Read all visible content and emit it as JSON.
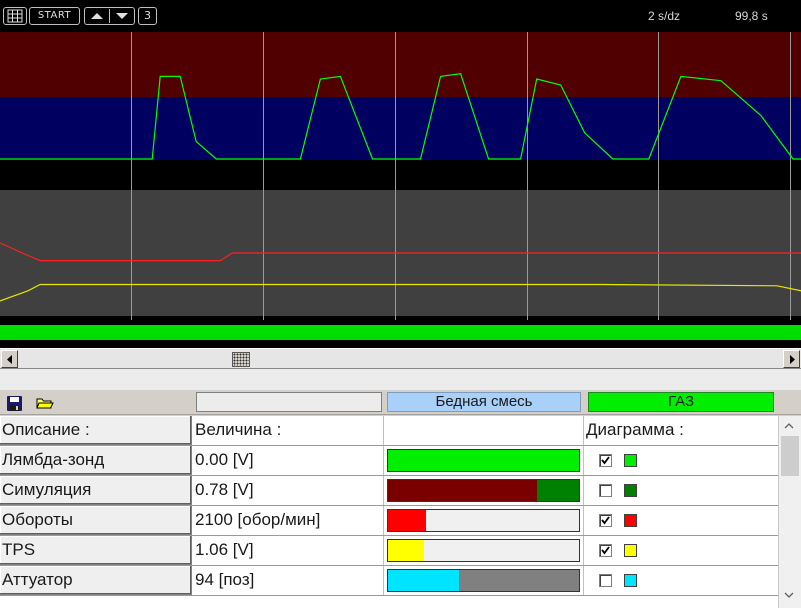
{
  "toolbar": {
    "start_label": "START",
    "channel_count": "3",
    "time_scale": "2 s/dz",
    "time_position": "99,8 s"
  },
  "chart_data": {
    "type": "line",
    "x_range_seconds": [
      0,
      20
    ],
    "time_divisions": 6,
    "series": [
      {
        "color": "#00ff00",
        "lane": "upper",
        "x": [
          0,
          3.8,
          4.0,
          4.5,
          4.9,
          5.4,
          6.3,
          7.5,
          8.0,
          8.5,
          9.3,
          10.5,
          11.0,
          11.5,
          12.2,
          13.0,
          13.4,
          14.0,
          14.6,
          15.3,
          16.2,
          17.0,
          18.0,
          19.0,
          19.8,
          20.0
        ],
        "values": [
          0,
          0,
          0.95,
          0.95,
          0.2,
          0,
          0,
          0,
          0.92,
          0.95,
          0,
          0,
          0.95,
          0.98,
          0,
          0,
          0.92,
          0.85,
          0.3,
          0,
          0,
          0.95,
          0.9,
          0.5,
          0,
          0
        ]
      },
      {
        "color": "#ff2020",
        "lane": "lower",
        "x": [
          0,
          0.7,
          1.0,
          5.5,
          5.8,
          20
        ],
        "values": [
          0.58,
          0.48,
          0.44,
          0.44,
          0.5,
          0.5
        ]
      },
      {
        "color": "#e6e600",
        "lane": "lower",
        "x": [
          0,
          0.7,
          1.0,
          5.0,
          10.0,
          15.0,
          19.4,
          20
        ],
        "values": [
          0.12,
          0.2,
          0.25,
          0.25,
          0.25,
          0.25,
          0.24,
          0.2
        ]
      }
    ]
  },
  "header": {
    "mode_label": "Бедная смесь",
    "mode_color": "#a8d0f8",
    "fuel_label": "ГАЗ",
    "fuel_color": "#00ee00"
  },
  "columns": {
    "name": "Описание :",
    "value": "Величина :",
    "diagram": "Диаграмма :"
  },
  "rows": [
    {
      "name": "Лямбда-зонд",
      "value": "0.00 [V]",
      "fill": 1.0,
      "fill_color": "#00ee00",
      "rest_color": "#f0f0f0",
      "checked": true,
      "swatch": "#00ee00"
    },
    {
      "name": "Симуляция",
      "value": "0.78 [V]",
      "fill": 0.78,
      "fill_color": "#7a0000",
      "rest_color": "#008000",
      "checked": false,
      "swatch": "#008000"
    },
    {
      "name": "Обороты",
      "value": "2100 [обор/мин]",
      "fill": 0.2,
      "fill_color": "#ff0000",
      "rest_color": "#f0f0f0",
      "checked": true,
      "swatch": "#ff0000"
    },
    {
      "name": "TPS",
      "value": "1.06 [V]",
      "fill": 0.19,
      "fill_color": "#ffff00",
      "rest_color": "#f0f0f0",
      "checked": true,
      "swatch": "#ffff00"
    },
    {
      "name": "Аттуатор",
      "value": "94 [поз]",
      "fill": 0.37,
      "fill_color": "#00e5ff",
      "rest_color": "#808080",
      "checked": false,
      "swatch": "#00e5ff"
    }
  ]
}
